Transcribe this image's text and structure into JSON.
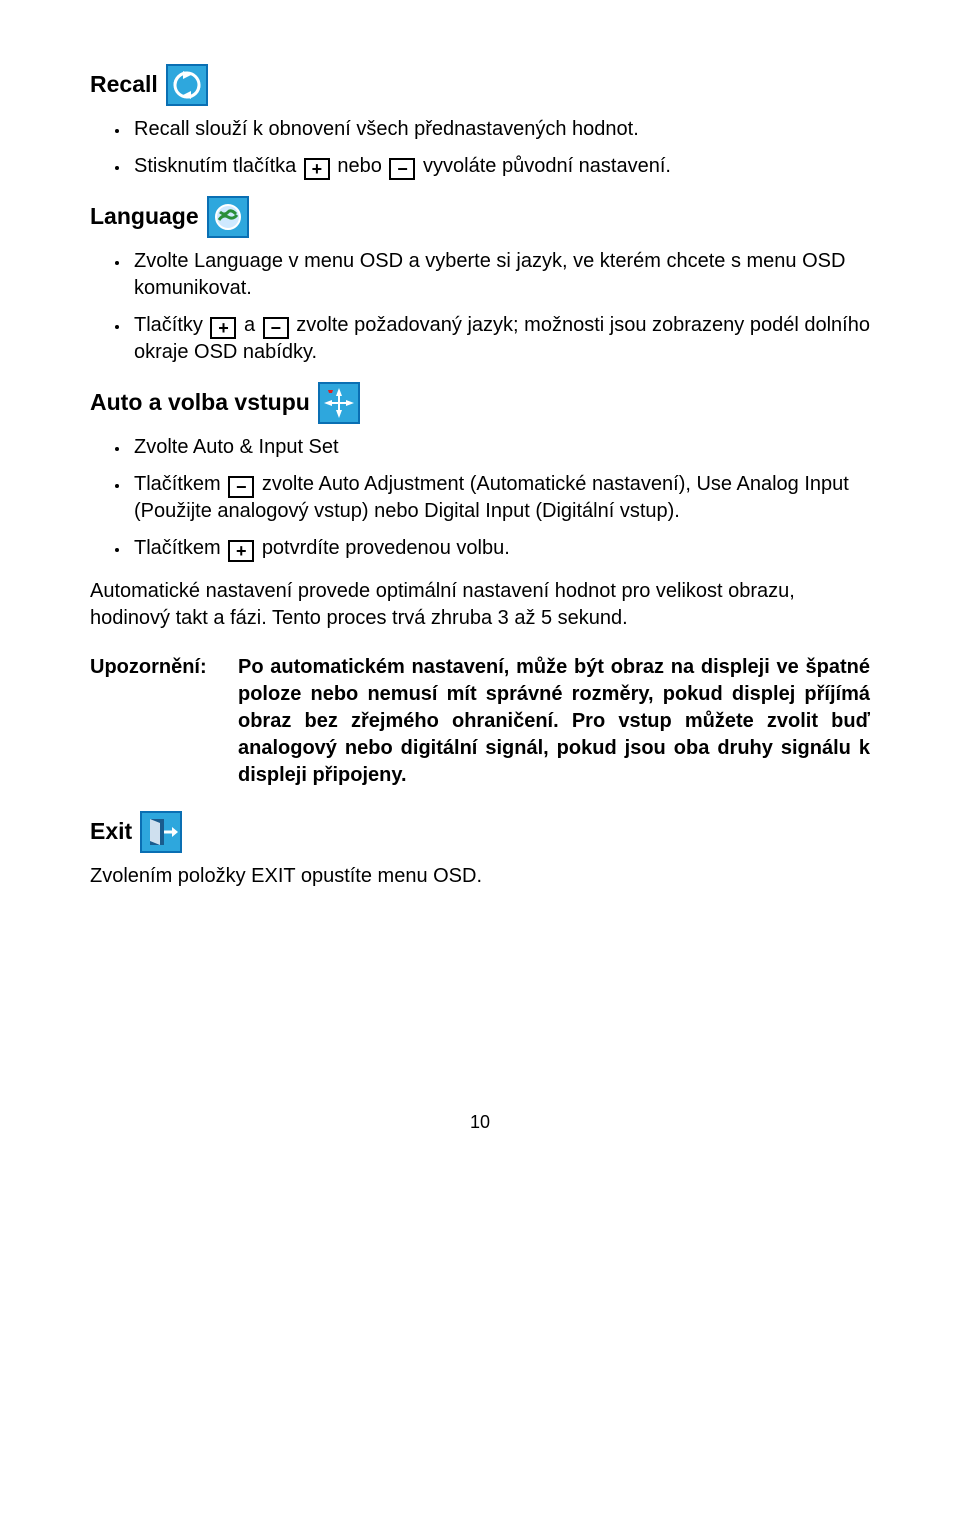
{
  "recall": {
    "heading": "Recall",
    "bullet1": "Recall slouží k obnovení všech přednastavených hodnot.",
    "bullet2_pre": "Stisknutím tlačítka ",
    "bullet2_mid": " nebo ",
    "bullet2_post": " vyvoláte původní nastavení."
  },
  "language": {
    "heading": "Language",
    "bullet1": "Zvolte Language v menu OSD a vyberte si jazyk, ve kterém chcete s menu OSD komunikovat.",
    "bullet2_pre": "Tlačítky ",
    "bullet2_mid": " a ",
    "bullet2_post": " zvolte požadovaný jazyk; možnosti jsou zobrazeny podél dolního okraje OSD nabídky."
  },
  "auto": {
    "heading": "Auto a volba vstupu",
    "bullet1": "Zvolte Auto & Input Set",
    "bullet2_pre": "Tlačítkem ",
    "bullet2_post": " zvolte Auto Adjustment (Automatické nastavení), Use Analog Input (Použijte analogový vstup) nebo Digital Input (Digitální vstup).",
    "bullet3_pre": "Tlačítkem ",
    "bullet3_post": " potvrdíte provedenou volbu.",
    "para": "Automatické nastavení provede optimální nastavení hodnot pro velikost obrazu, hodinový takt a fázi. Tento proces trvá zhruba 3 až 5 sekund."
  },
  "notice": {
    "label": "Upozornění:",
    "body": "Po automatickém nastavení, může být obraz na displeji ve špatné poloze nebo nemusí mít správné rozměry, pokud displej příjímá obraz bez zřejmého ohraničení. Pro vstup můžete zvolit buď analogový nebo digitální signál, pokud jsou oba druhy signálu k displeji připojeny."
  },
  "exit": {
    "heading": "Exit",
    "para": "Zvolením položky EXIT opustíte menu OSD."
  },
  "page_number": "10",
  "glyphs": {
    "plus": "+",
    "minus": "−"
  }
}
